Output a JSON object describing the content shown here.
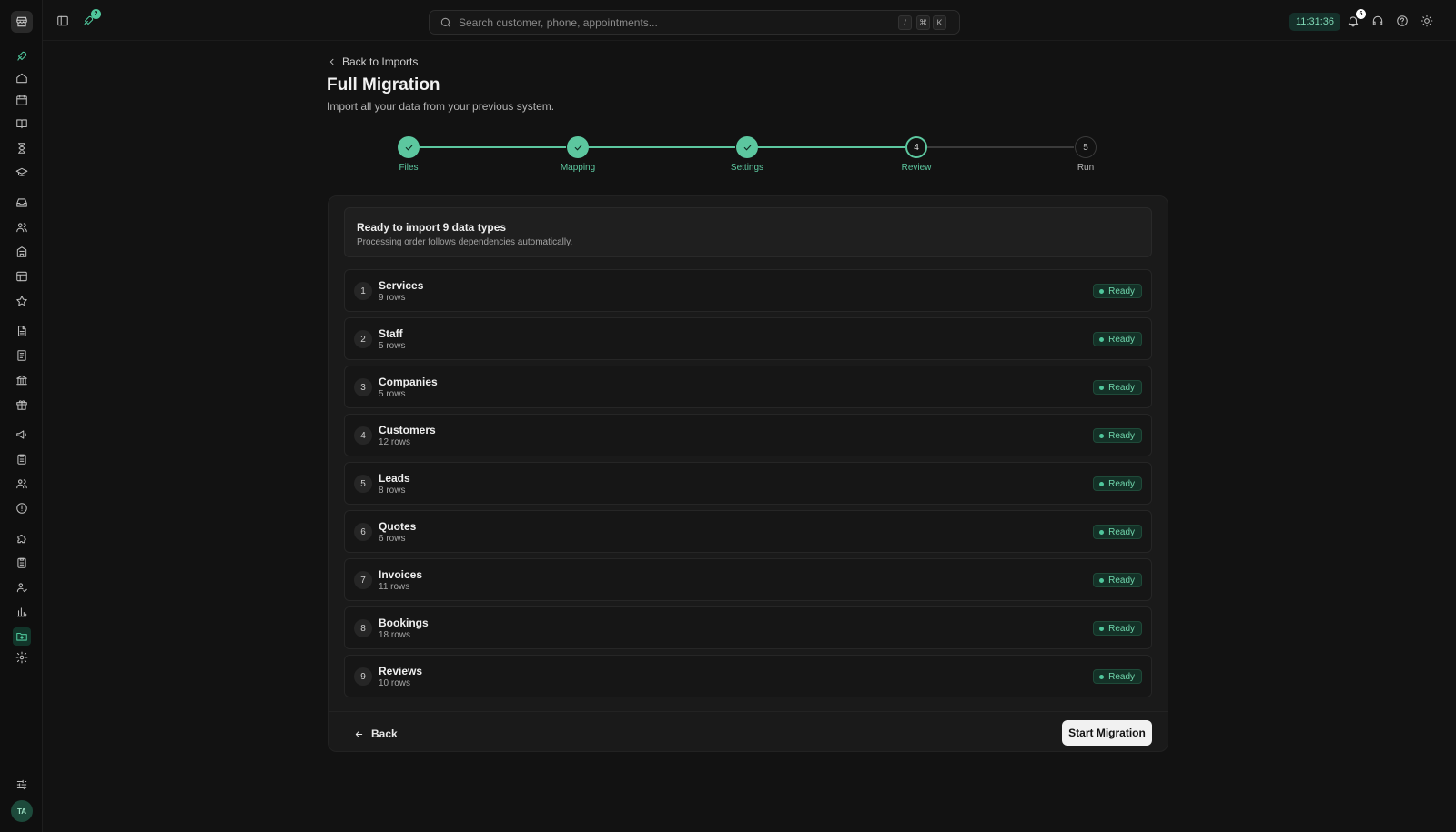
{
  "topbar": {
    "search_placeholder": "Search customer, phone, appointments...",
    "kbd_slash": "/",
    "kbd_cmd": "⌘",
    "kbd_k": "K",
    "clock": "11:31:36",
    "launch_badge": "2",
    "notifications_badge": "5"
  },
  "sidebar": {
    "avatar_initials": "TA",
    "active_item": "imports"
  },
  "header": {
    "back_link": "Back to Imports",
    "title": "Full Migration",
    "subtitle": "Import all your data from your previous system."
  },
  "stepper": {
    "steps": [
      {
        "label": "Files",
        "state": "done"
      },
      {
        "label": "Mapping",
        "state": "done"
      },
      {
        "label": "Settings",
        "state": "done"
      },
      {
        "label": "Review",
        "number": "4",
        "state": "current"
      },
      {
        "label": "Run",
        "number": "5",
        "state": "todo"
      }
    ]
  },
  "summary": {
    "title": "Ready to import 9 data types",
    "description": "Processing order follows dependencies automatically."
  },
  "items": [
    {
      "num": "1",
      "name": "Services",
      "count": "9 rows",
      "status": "Ready"
    },
    {
      "num": "2",
      "name": "Staff",
      "count": "5 rows",
      "status": "Ready"
    },
    {
      "num": "3",
      "name": "Companies",
      "count": "5 rows",
      "status": "Ready"
    },
    {
      "num": "4",
      "name": "Customers",
      "count": "12 rows",
      "status": "Ready"
    },
    {
      "num": "5",
      "name": "Leads",
      "count": "8 rows",
      "status": "Ready"
    },
    {
      "num": "6",
      "name": "Quotes",
      "count": "6 rows",
      "status": "Ready"
    },
    {
      "num": "7",
      "name": "Invoices",
      "count": "11 rows",
      "status": "Ready"
    },
    {
      "num": "8",
      "name": "Bookings",
      "count": "18 rows",
      "status": "Ready"
    },
    {
      "num": "9",
      "name": "Reviews",
      "count": "10 rows",
      "status": "Ready"
    }
  ],
  "footer": {
    "back_label": "Back",
    "start_label": "Start Migration"
  },
  "colors": {
    "accent": "#4fc79c",
    "background": "#121212",
    "card": "#1a1a1a"
  }
}
